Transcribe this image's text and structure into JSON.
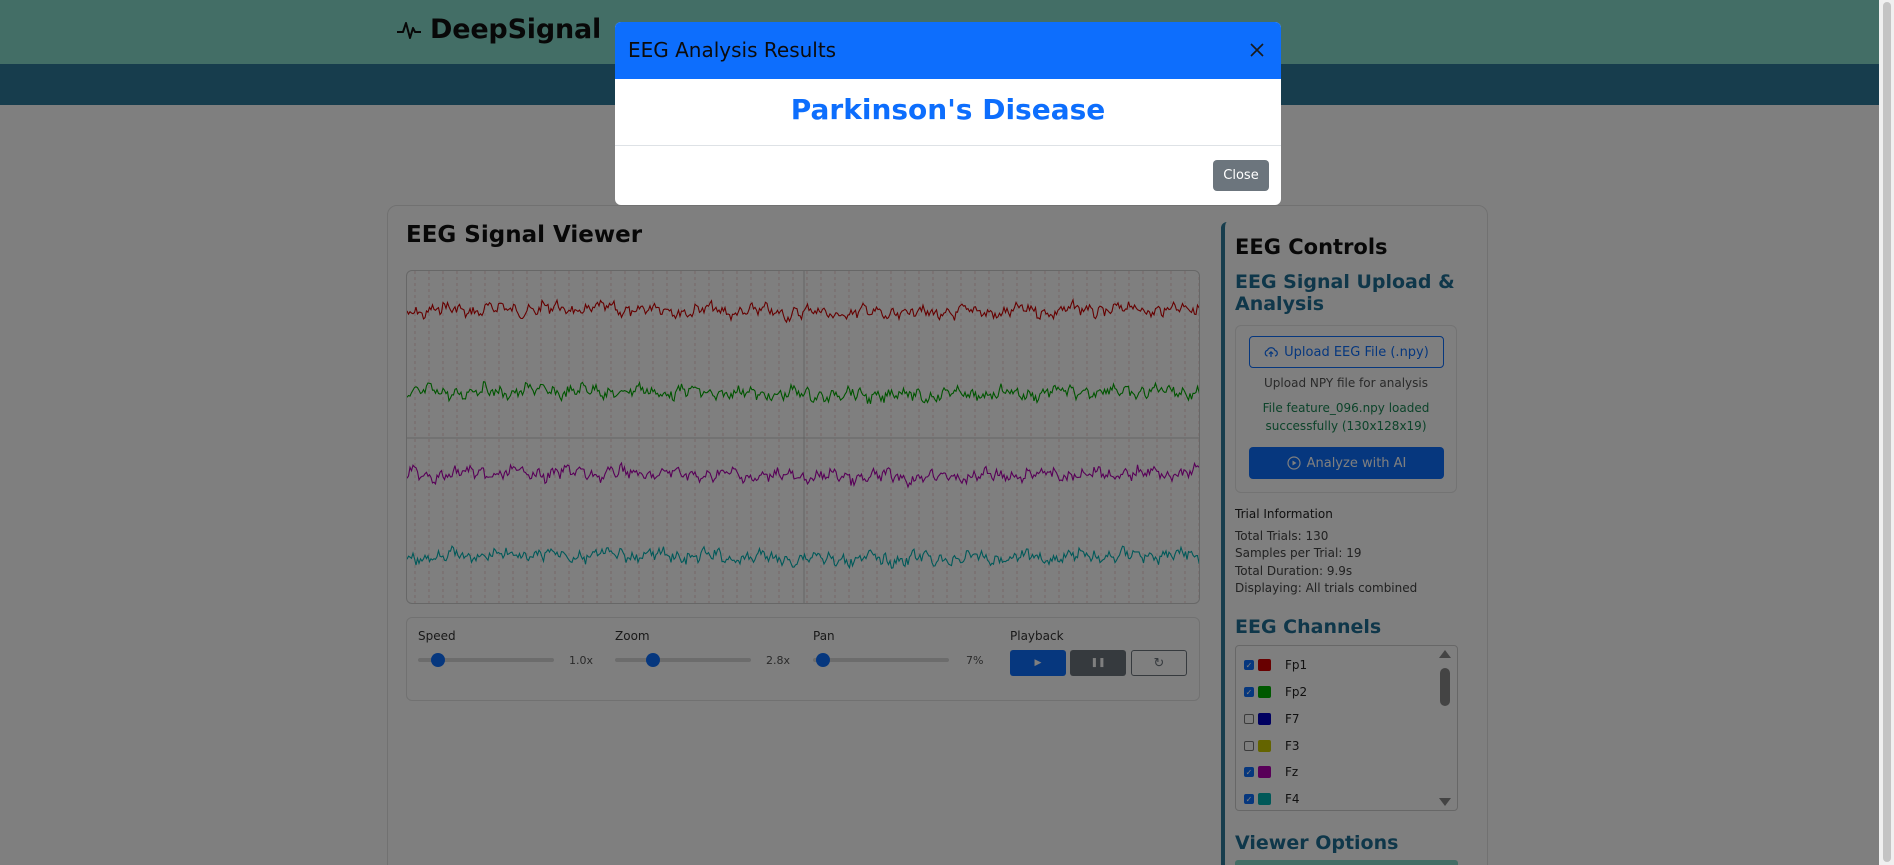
{
  "header": {
    "brand_name": "DeepSignal",
    "brand_icon": "pulse-icon",
    "colors": {
      "topbar": "#86dccc",
      "navbar": "#2f7b9a"
    }
  },
  "viewer": {
    "title": "EEG Signal Viewer",
    "traces": [
      {
        "channel": "Fp1",
        "color": "#cc0000"
      },
      {
        "channel": "Fp2",
        "color": "#00aa00"
      },
      {
        "channel": "Fz",
        "color": "#b000b0"
      },
      {
        "channel": "F4",
        "color": "#00b3b3"
      }
    ]
  },
  "controls": {
    "speed": {
      "label": "Speed",
      "value": "1.0x",
      "fraction": 0.15
    },
    "zoom": {
      "label": "Zoom",
      "value": "2.8x",
      "fraction": 0.28
    },
    "pan": {
      "label": "Pan",
      "value": "7%",
      "fraction": 0.07
    },
    "playback": {
      "label": "Playback",
      "play_icon": "play-icon",
      "pause_icon": "pause-icon",
      "reset_icon": "reset-icon"
    }
  },
  "side": {
    "title": "EEG Controls",
    "subtitle": "EEG Signal Upload & Analysis",
    "upload_button": "Upload EEG File (.npy)",
    "upload_hint": "Upload NPY file for analysis",
    "upload_status_line1": "File feature_096.npy loaded",
    "upload_status_line2": "successfully (130x128x19)",
    "analyze_button": "Analyze with AI",
    "trial_info": {
      "heading": "Trial Information",
      "total_trials": "Total Trials: 130",
      "samples_per_trial": "Samples per Trial: 19",
      "total_duration": "Total Duration: 9.9s",
      "displaying": "Displaying: All trials combined"
    },
    "channels_title": "EEG Channels",
    "channels": [
      {
        "name": "Fp1",
        "checked": true,
        "color": "#d00000"
      },
      {
        "name": "Fp2",
        "checked": true,
        "color": "#00b000"
      },
      {
        "name": "F7",
        "checked": false,
        "color": "#0000c0"
      },
      {
        "name": "F3",
        "checked": false,
        "color": "#c8c800"
      },
      {
        "name": "Fz",
        "checked": true,
        "color": "#b000b0"
      },
      {
        "name": "F4",
        "checked": true,
        "color": "#00b0b0"
      }
    ],
    "viewer_options_title": "Viewer Options"
  },
  "modal": {
    "title": "EEG Analysis Results",
    "result": "Parkinson's Disease",
    "close_button": "Close",
    "colors": {
      "header": "#0d6efd",
      "result_text": "#0d6efd",
      "close_button": "#6c757d"
    }
  }
}
